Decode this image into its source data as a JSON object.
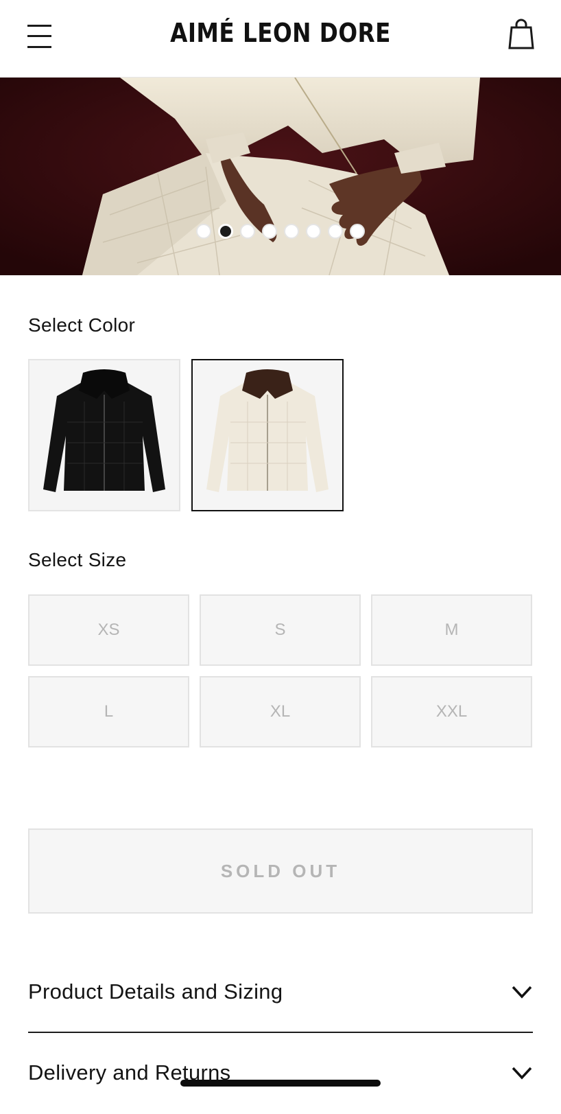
{
  "header": {
    "brand": "AIMÉ LEON DORE",
    "menu_icon": "hamburger-menu-icon",
    "cart_icon": "shopping-bag-icon"
  },
  "carousel": {
    "slide_count": 8,
    "active_index": 1
  },
  "colors_section": {
    "label": "Select Color",
    "options": [
      {
        "name": "black",
        "body": "#121212",
        "collar": "#0a0a0a",
        "selected": false
      },
      {
        "name": "cream",
        "body": "#efe9dc",
        "collar": "#3a2218",
        "selected": true
      }
    ]
  },
  "sizes_section": {
    "label": "Select Size",
    "sizes": [
      "XS",
      "S",
      "M",
      "L",
      "XL",
      "XXL"
    ]
  },
  "cta": {
    "label": "SOLD OUT"
  },
  "accordions": [
    {
      "title": "Product Details and Sizing",
      "icon": "chevron-down-icon"
    },
    {
      "title": "Delivery and Returns",
      "icon": "chevron-down-icon"
    }
  ],
  "theme": {
    "text": "#141414",
    "disabled_text": "#b5b5b5",
    "disabled_bg": "#f6f6f6",
    "hero_bg": "#3a0d10"
  }
}
